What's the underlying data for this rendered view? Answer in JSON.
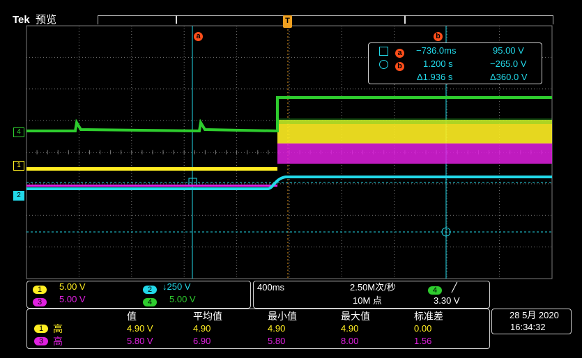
{
  "header": {
    "brand": "Tek",
    "mode": "预览"
  },
  "markers": {
    "trigger": "T",
    "cursor_a": "a",
    "cursor_b": "b"
  },
  "channel_markers": [
    {
      "id": "4",
      "color": "#2ecc2e"
    },
    {
      "id": "1",
      "color": "#ffee22"
    },
    {
      "id": "2",
      "color": "#22d8e8"
    }
  ],
  "cursor_readout": {
    "a_time": "−736.0ms",
    "a_value": "95.00 V",
    "b_time": "1.200 s",
    "b_value": "−265.0 V",
    "delta_time": "Δ1.936 s",
    "delta_value": "Δ360.0 V"
  },
  "channels_panel": {
    "ch1": {
      "num": "1",
      "scale": "5.00 V"
    },
    "ch2": {
      "num": "2",
      "scale": "↓250 V"
    },
    "ch3": {
      "num": "3",
      "scale": "5.00 V"
    },
    "ch4": {
      "num": "4",
      "scale": "5.00 V"
    }
  },
  "horizontal_panel": {
    "timebase": "400ms",
    "sample_rate": "2.50M次/秒",
    "record_length": "10M 点",
    "trigger_source": "4",
    "trigger_slope": "╱",
    "trigger_level": "3.30 V"
  },
  "measurements": {
    "headers": [
      "值",
      "平均值",
      "最小值",
      "最大值",
      "标准差"
    ],
    "rows": [
      {
        "channel": "1",
        "label": "高",
        "values": [
          "4.90 V",
          "4.90",
          "4.90",
          "4.90",
          "0.00"
        ]
      },
      {
        "channel": "3",
        "label": "高",
        "values": [
          "5.80 V",
          "6.90",
          "5.80",
          "8.00",
          "1.56"
        ]
      }
    ]
  },
  "datetime": {
    "date": "28 5月 2020",
    "time": "16:34:32"
  },
  "colors": {
    "ch1": "#ffee22",
    "ch2": "#22d8e8",
    "ch3": "#e020e0",
    "ch4": "#2ecc2e",
    "cursor": "#ff4e1a",
    "grid": "#7a7a7a",
    "trigger": "#f0a020"
  }
}
